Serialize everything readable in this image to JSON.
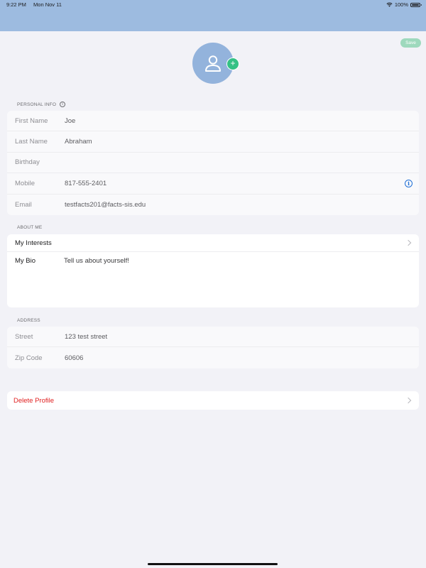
{
  "status_bar": {
    "time": "9:22 PM",
    "date": "Mon Nov 11",
    "battery": "100%"
  },
  "toolbar": {
    "save_label": "Save"
  },
  "avatar": {
    "add_label": "+"
  },
  "personal_info": {
    "header": "PERSONAL INFO",
    "rows": [
      {
        "label": "First Name",
        "value": "Joe"
      },
      {
        "label": "Last Name",
        "value": "Abraham"
      },
      {
        "label": "Birthday",
        "value": ""
      },
      {
        "label": "Mobile",
        "value": "817-555-2401"
      },
      {
        "label": "Email",
        "value": "testfacts201@facts-sis.edu"
      }
    ]
  },
  "about_me": {
    "header": "ABOUT ME",
    "interests_label": "My Interests",
    "bio_label": "My Bio",
    "bio_placeholder": "Tell us about yourself!"
  },
  "address": {
    "header": "ADDRESS",
    "rows": [
      {
        "label": "Street",
        "value": "123 test street"
      },
      {
        "label": "Zip Code",
        "value": "60606"
      }
    ]
  },
  "actions": {
    "delete_label": "Delete Profile"
  },
  "colors": {
    "nav_bar": "#9dbbe0",
    "accent_green": "#34c185",
    "info_blue": "#1f6fd6",
    "destructive_red": "#e02020"
  }
}
